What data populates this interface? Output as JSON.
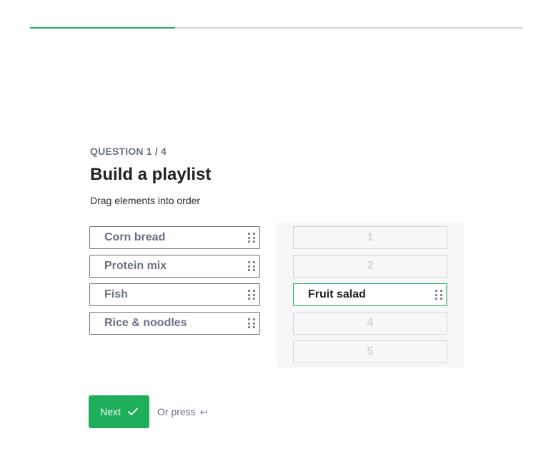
{
  "progress": {
    "fraction": 0.294
  },
  "question": {
    "label": "QUESTION 1 / 4",
    "title": "Build a playlist",
    "instruction": "Drag elements into order"
  },
  "source_items": [
    {
      "label": "Corn bread",
      "icon": "drag-handle-icon"
    },
    {
      "label": "Protein mix",
      "icon": "drag-handle-icon"
    },
    {
      "label": "Fish",
      "icon": "drag-handle-icon"
    },
    {
      "label": "Rice & noodles",
      "icon": "drag-handle-icon"
    }
  ],
  "target_slots": [
    {
      "position": "1",
      "item": null
    },
    {
      "position": "2",
      "item": null
    },
    {
      "position": "3",
      "item": "Fruit salad"
    },
    {
      "position": "4",
      "item": null
    },
    {
      "position": "5",
      "item": null
    }
  ],
  "actions": {
    "next_label": "Next",
    "next_icon": "check-icon",
    "hint_text": "Or press",
    "hint_icon": "enter-key-icon",
    "hint_glyph": "↩"
  },
  "colors": {
    "accent": "#1fae5b",
    "muted_text": "#6b7185",
    "slot_border": "#d5d6d9"
  }
}
